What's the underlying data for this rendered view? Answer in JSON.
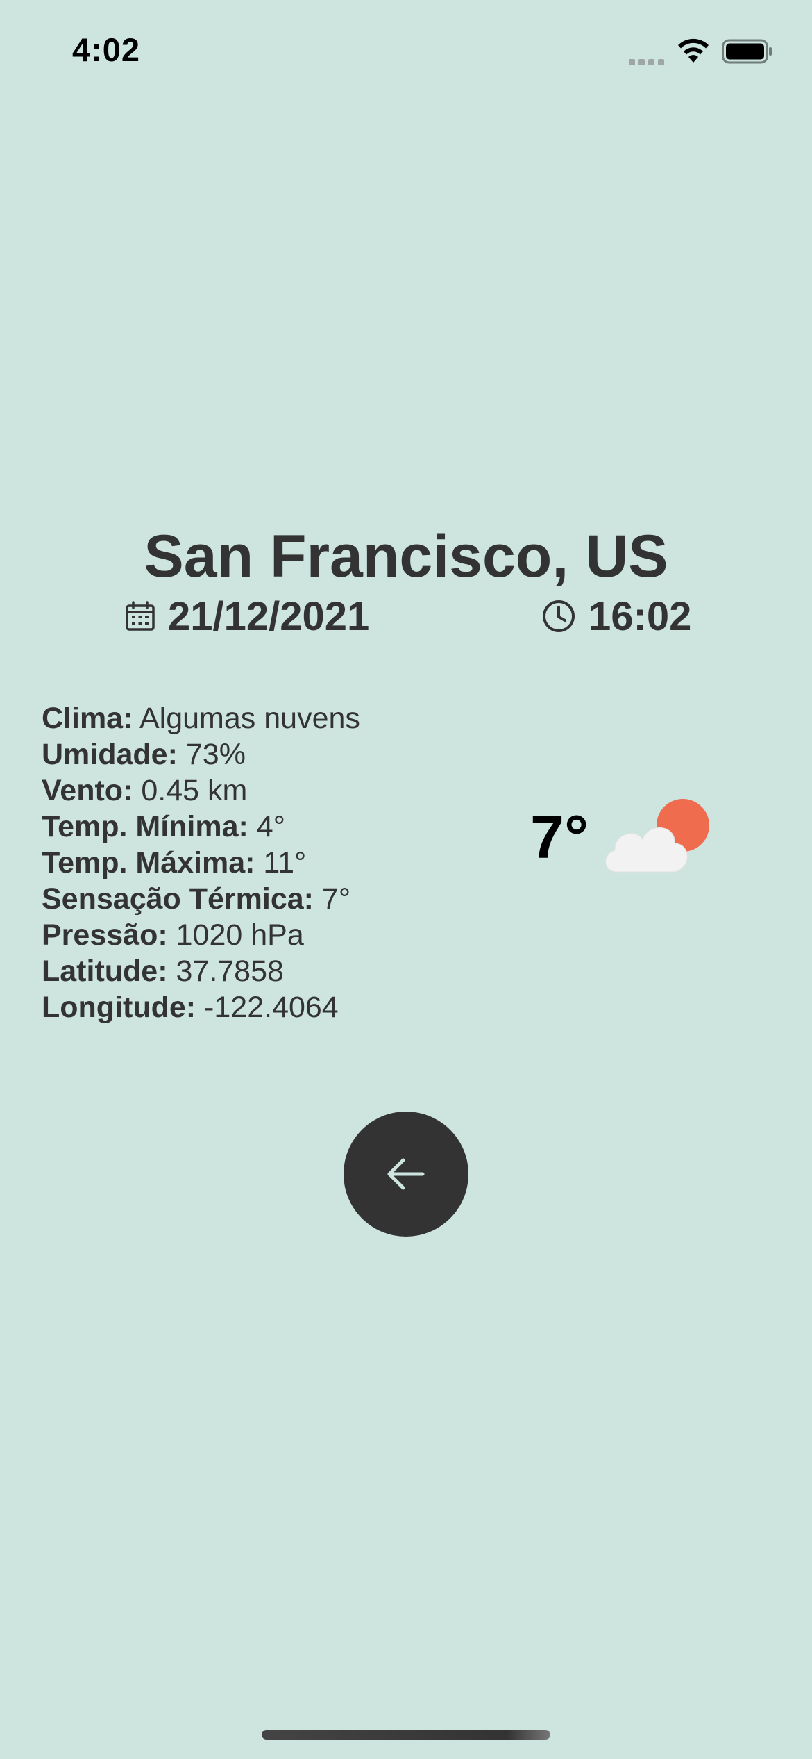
{
  "status_bar": {
    "time": "4:02",
    "signal_icon": "cellular-signal-icon",
    "wifi_icon": "wifi-icon",
    "battery_icon": "battery-full-icon"
  },
  "location": {
    "title": "San Francisco, US"
  },
  "datetime": {
    "date_icon": "calendar-icon",
    "date": "21/12/2021",
    "time_icon": "clock-icon",
    "time": "16:02"
  },
  "details": [
    {
      "label": "Clima:",
      "value": " Algumas nuvens"
    },
    {
      "label": "Umidade:",
      "value": " 73%"
    },
    {
      "label": "Vento:",
      "value": " 0.45 km"
    },
    {
      "label": "Temp. Mínima:",
      "value": " 4°"
    },
    {
      "label": "Temp. Máxima:",
      "value": " 11°"
    },
    {
      "label": "Sensação Térmica:",
      "value": " 7°"
    },
    {
      "label": "Pressão:",
      "value": " 1020 hPa"
    },
    {
      "label": "Latitude:",
      "value": " 37.7858"
    },
    {
      "label": "Longitude:",
      "value": " -122.4064"
    }
  ],
  "current": {
    "temperature": "7°",
    "icon": "partly-cloudy-icon"
  },
  "actions": {
    "back_icon": "arrow-left-icon"
  },
  "colors": {
    "background": "#cde4df",
    "text": "#333333",
    "button": "#333333",
    "sun": "#ef6c4f",
    "cloud": "#f2f2f2",
    "arrow": "#cde4df"
  }
}
